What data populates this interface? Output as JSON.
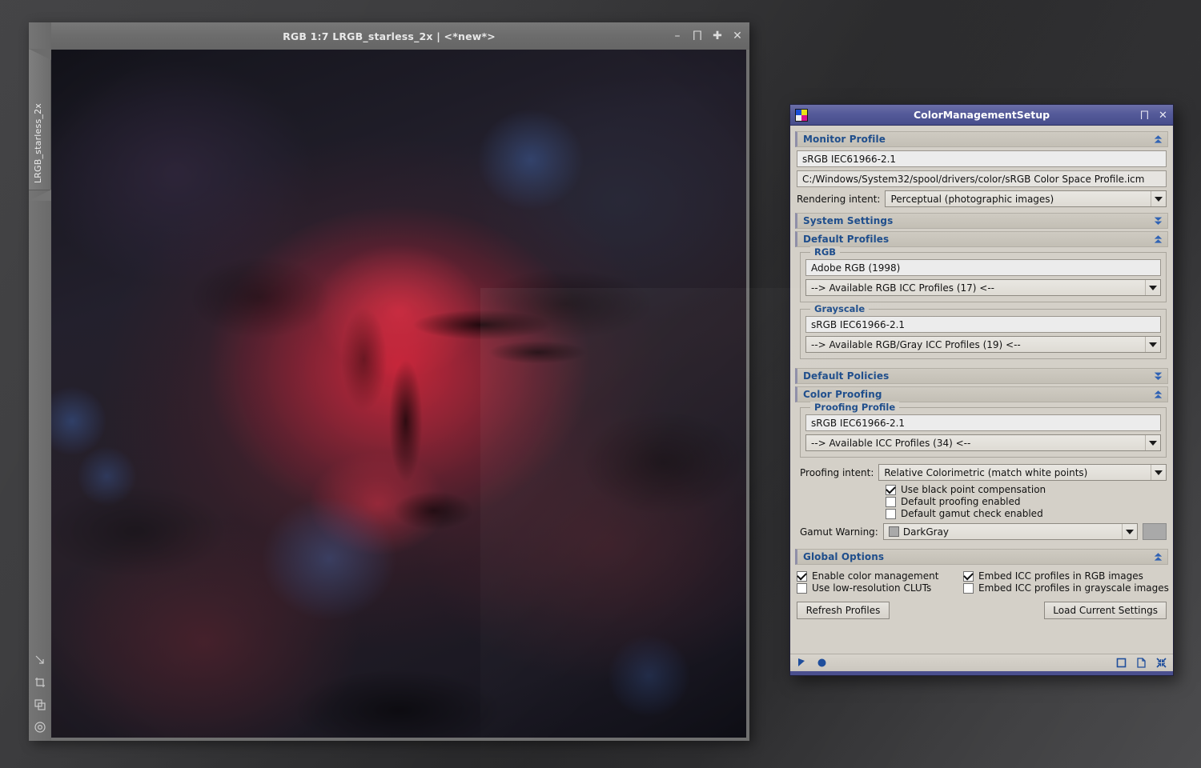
{
  "image_window": {
    "title": "RGB 1:7 LRGB_starless_2x | <*new*>",
    "tab_label": "LRGB_starless_2x",
    "window_buttons": [
      {
        "name": "minimize",
        "glyph": "–"
      },
      {
        "name": "shade",
        "glyph": "⨅"
      },
      {
        "name": "maximize",
        "glyph": "✚"
      },
      {
        "name": "close",
        "glyph": "✕"
      }
    ],
    "tool_icons": [
      "resize-arrow-icon",
      "crop-frame-icon",
      "duplicate-icon",
      "target-circle-icon"
    ]
  },
  "dialog": {
    "title": "ColorManagementSetup",
    "app_icon": "color-squares-icon",
    "window_buttons": [
      {
        "name": "shade",
        "glyph": "⨅"
      },
      {
        "name": "close",
        "glyph": "✕"
      }
    ],
    "sections": {
      "monitor_profile": {
        "header": "Monitor Profile",
        "expanded": true,
        "profile_name": "sRGB IEC61966-2.1",
        "profile_path": "C:/Windows/System32/spool/drivers/color/sRGB Color Space Profile.icm",
        "rendering_intent_label": "Rendering intent:",
        "rendering_intent_value": "Perceptual (photographic images)"
      },
      "system_settings": {
        "header": "System Settings",
        "expanded": false
      },
      "default_profiles": {
        "header": "Default Profiles",
        "expanded": true,
        "rgb": {
          "group_label": "RGB",
          "profile_name": "Adobe RGB (1998)",
          "combo_value": "--> Available RGB ICC Profiles (17) <--"
        },
        "grayscale": {
          "group_label": "Grayscale",
          "profile_name": "sRGB IEC61966-2.1",
          "combo_value": "--> Available RGB/Gray ICC Profiles (19) <--"
        }
      },
      "default_policies": {
        "header": "Default Policies",
        "expanded": false
      },
      "color_proofing": {
        "header": "Color Proofing",
        "expanded": true,
        "proofing_profile": {
          "group_label": "Proofing Profile",
          "profile_name": "sRGB IEC61966-2.1",
          "combo_value": "--> Available ICC Profiles (34) <--"
        },
        "proofing_intent_label": "Proofing intent:",
        "proofing_intent_value": "Relative Colorimetric (match white points)",
        "checkboxes": [
          {
            "label": "Use black point compensation",
            "checked": true
          },
          {
            "label": "Default proofing enabled",
            "checked": false
          },
          {
            "label": "Default gamut check enabled",
            "checked": false
          }
        ],
        "gamut_warning_label": "Gamut Warning:",
        "gamut_warning_value": "DarkGray",
        "gamut_warning_color": "#a9a9a9"
      },
      "global_options": {
        "header": "Global Options",
        "expanded": true,
        "checkboxes_left": [
          {
            "label": "Enable color management",
            "checked": true
          },
          {
            "label": "Use low-resolution CLUTs",
            "checked": false
          }
        ],
        "checkboxes_right": [
          {
            "label": "Embed ICC profiles in RGB images",
            "checked": true
          },
          {
            "label": "Embed ICC profiles in grayscale images",
            "checked": false
          }
        ],
        "refresh_button": "Refresh Profiles",
        "load_button": "Load Current Settings"
      }
    },
    "status_bar": {
      "left_icons": [
        "arrow-cursor-icon",
        "blue-dot-icon"
      ],
      "right_icons": [
        "square-icon",
        "document-icon",
        "collapse-icon"
      ]
    }
  },
  "colors": {
    "dialog_background": "#d4d0c8",
    "titlebar_accent": "#545a99",
    "section_header_text": "#1f4e8c",
    "desktop": "#343436"
  }
}
